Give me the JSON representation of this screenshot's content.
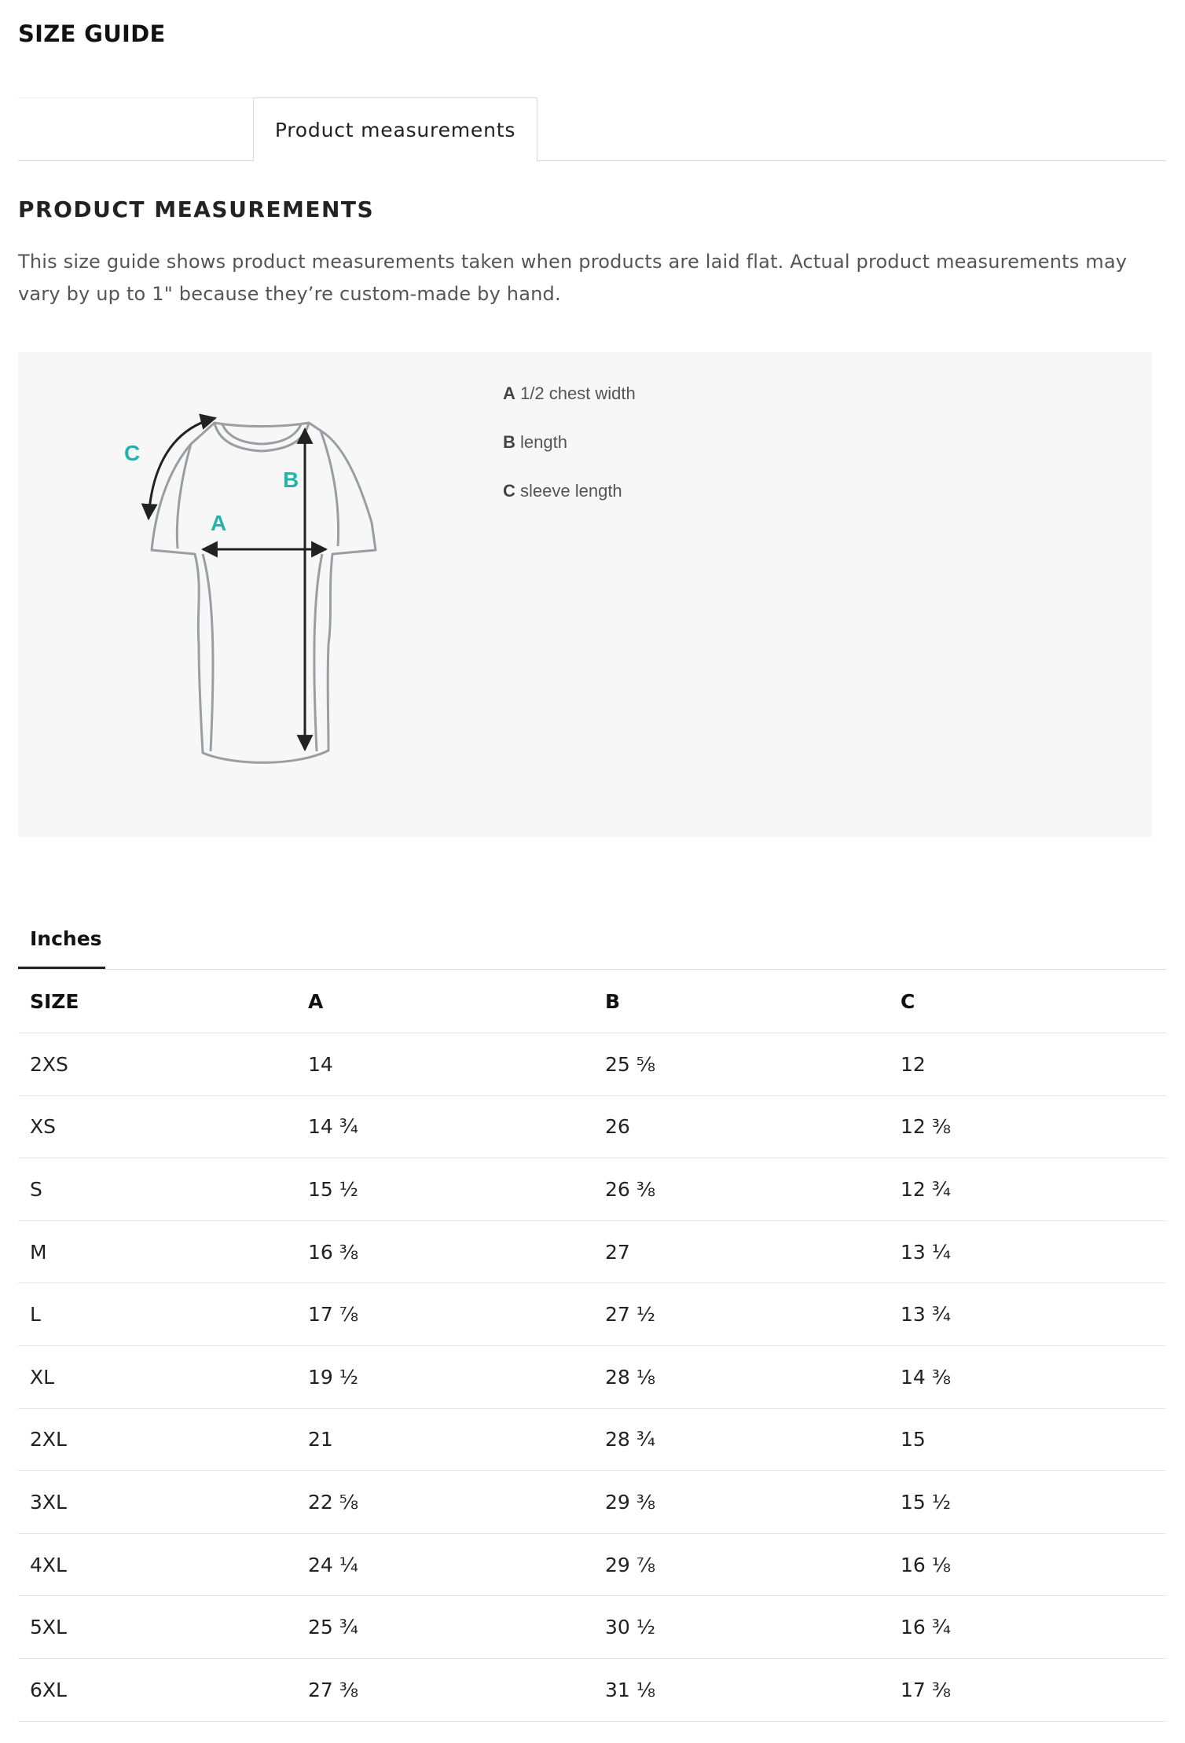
{
  "page": {
    "title": "SIZE GUIDE"
  },
  "tabs": [
    {
      "label": ""
    },
    {
      "label": "Product measurements"
    }
  ],
  "section": {
    "heading": "PRODUCT MEASUREMENTS",
    "intro": "This size guide shows product measurements taken when products are laid flat. Actual product measurements may vary by up to 1\" because they’re custom-made by hand."
  },
  "diagram": {
    "markers": {
      "a": "A",
      "b": "B",
      "c": "C"
    },
    "accent_color": "#1fb5a8",
    "legend": [
      {
        "key": "A",
        "text": "1/2 chest width"
      },
      {
        "key": "B",
        "text": "length"
      },
      {
        "key": "C",
        "text": "sleeve length"
      }
    ]
  },
  "units": {
    "active_label": "Inches"
  },
  "table": {
    "headers": [
      "SIZE",
      "A",
      "B",
      "C"
    ],
    "rows": [
      [
        "2XS",
        "14",
        "25 ⅝",
        "12"
      ],
      [
        "XS",
        "14 ¾",
        "26",
        "12 ⅜"
      ],
      [
        "S",
        "15 ½",
        "26 ⅜",
        "12 ¾"
      ],
      [
        "M",
        "16 ⅜",
        "27",
        "13 ¼"
      ],
      [
        "L",
        "17 ⅞",
        "27 ½",
        "13 ¾"
      ],
      [
        "XL",
        "19 ½",
        "28 ⅛",
        "14 ⅜"
      ],
      [
        "2XL",
        "21",
        "28 ¾",
        "15"
      ],
      [
        "3XL",
        "22 ⅝",
        "29 ⅜",
        "15 ½"
      ],
      [
        "4XL",
        "24 ¼",
        "29 ⅞",
        "16 ⅛"
      ],
      [
        "5XL",
        "25 ¾",
        "30 ½",
        "16 ¾"
      ],
      [
        "6XL",
        "27 ⅜",
        "31 ⅛",
        "17 ⅜"
      ]
    ]
  }
}
